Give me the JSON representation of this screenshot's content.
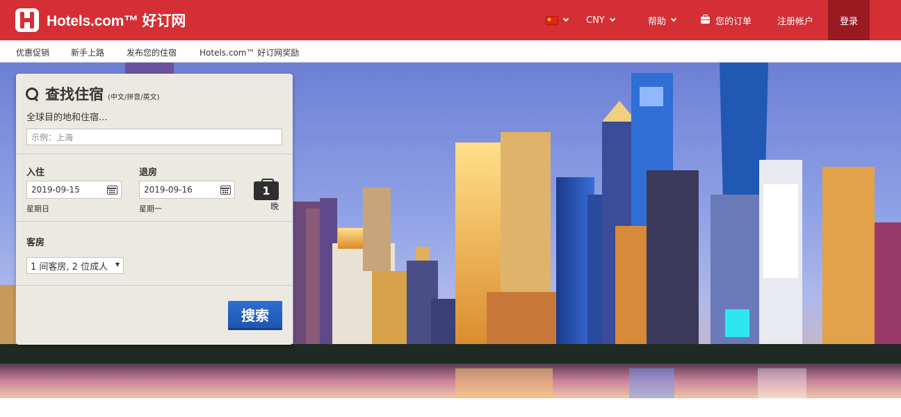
{
  "header": {
    "brand": "Hotels.com™ 好订网",
    "currency": "CNY",
    "help": "帮助",
    "orders": "您的订单",
    "register": "注册帐户",
    "login": "登录",
    "icons": [
      "china-flag-icon",
      "chevron-down-icon",
      "briefcase-icon"
    ],
    "brand_color": "#d32f35",
    "login_bg": "#9a1a22"
  },
  "subnav": {
    "items": [
      "优惠促销",
      "新手上路",
      "发布您的住宿",
      "Hotels.com™ 好订网奖励"
    ]
  },
  "search": {
    "title": "查找住宿",
    "title_hint": "(中文/拼音/英文)",
    "destination_label": "全球目的地和住宿...",
    "destination_placeholder": "示例：上海",
    "checkin_label": "入住",
    "checkin_value": "2019-09-15",
    "checkin_weekday": "星期日",
    "checkout_label": "退房",
    "checkout_value": "2019-09-16",
    "checkout_weekday": "星期一",
    "nights_value": "1",
    "nights_unit": "晚",
    "rooms_label": "客房",
    "rooms_value": "1 间客房, 2 位成人",
    "submit_label": "搜索",
    "button_color": "#1d56b0"
  }
}
